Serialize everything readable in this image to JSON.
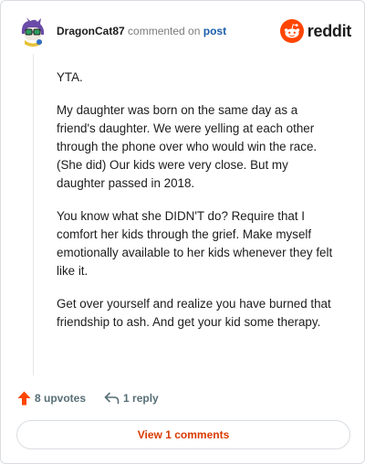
{
  "header": {
    "username": "DragonCat87",
    "action_text": "commented on",
    "post_link": "post",
    "brand": "reddit",
    "avatar_icon": "snoo-avatar-icon",
    "brand_icon": "reddit-alien-icon"
  },
  "comment": {
    "paragraphs": [
      "YTA.",
      "My daughter was born on the same day as a friend's daughter. We were yelling at each other through the phone over who would win the race. (She did) Our kids were very close. But my daughter passed in 2018.",
      "You know what she DIDN'T do? Require that I comfort her kids through the grief. Make myself emotionally available to her kids whenever they felt like it.",
      "Get over yourself and realize you have burned that friendship to ash. And get your kid some therapy."
    ]
  },
  "footer": {
    "upvotes": "8 upvotes",
    "replies": "1 reply",
    "view_comments": "View 1 comments",
    "upvote_icon": "upvote-arrow-icon",
    "reply_icon": "reply-arrow-icon"
  },
  "colors": {
    "accent": "#ff4500",
    "link": "#1a5dab",
    "view_button_text": "#d93a00",
    "muted": "#576f76"
  }
}
